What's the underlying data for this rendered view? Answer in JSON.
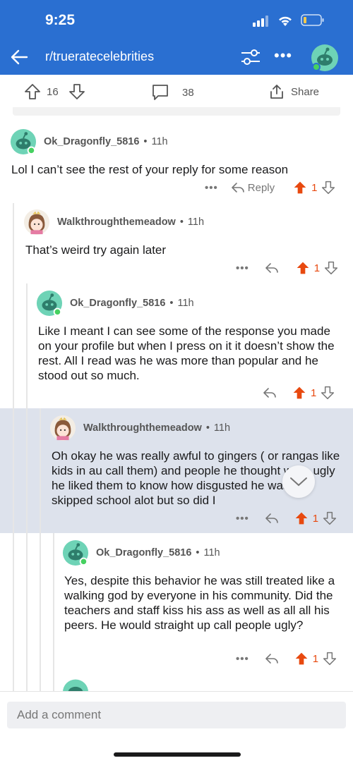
{
  "status": {
    "time": "9:25"
  },
  "header": {
    "subreddit": "r/trueratecelebrities"
  },
  "post_actions": {
    "upvotes": "16",
    "comments": "38",
    "share_label": "Share"
  },
  "comments": [
    {
      "user": "Ok_Dragonfly_5816",
      "time": "11h",
      "body": "Lol I can’t see the rest of your reply for some reason",
      "reply_label": "Reply",
      "score": "1"
    },
    {
      "user": "Walkthroughthemeadow",
      "time": "11h",
      "body": "That’s weird try again later",
      "score": "1"
    },
    {
      "user": "Ok_Dragonfly_5816",
      "time": "11h",
      "body": "Like I meant I can see some of the response you made on your profile but when I press on it it doesn’t show the rest. All I read was he was more than popular and he stood out so much.",
      "score": "1"
    },
    {
      "user": "Walkthroughthemeadow",
      "time": "11h",
      "body": "Oh okay he was really awful to gingers ( or rangas like kids in au call them) and people he thought were ugly he liked them to know how disgusted he was He skipped school alot but so did I",
      "score": "1"
    },
    {
      "user": "Ok_Dragonfly_5816",
      "time": "11h",
      "body": "Yes, despite this behavior he was still treated like a walking god by everyone in his community. Did the teachers and staff kiss his ass as well as all all his peers. He would straight up call people ugly?",
      "score": "1"
    }
  ],
  "composer": {
    "placeholder": "Add a comment"
  },
  "colors": {
    "header": "#2a6fd1",
    "upvote": "#e8490f",
    "highlight": "#dde2ec"
  }
}
